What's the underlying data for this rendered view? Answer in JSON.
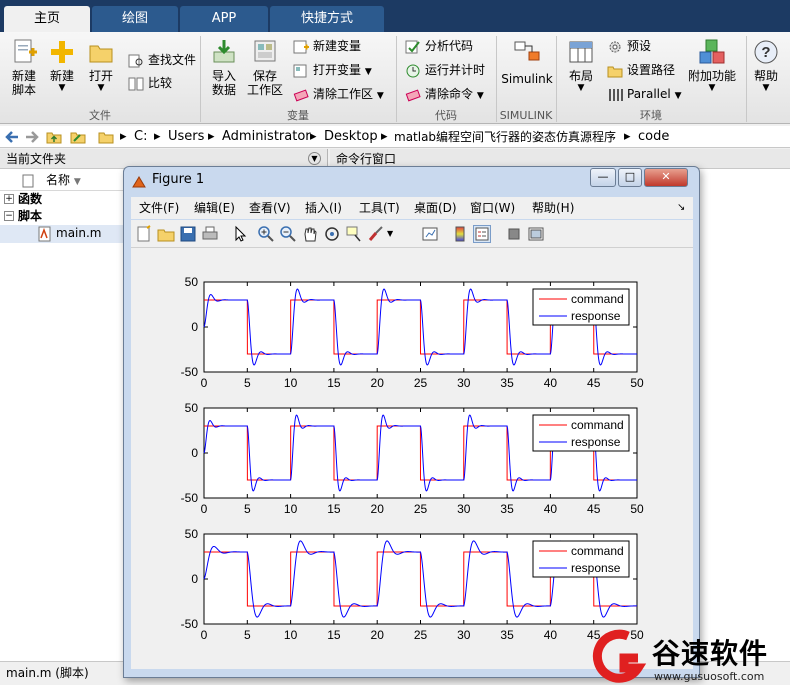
{
  "tabs": [
    {
      "label": "主页",
      "active": true
    },
    {
      "label": "绘图",
      "active": false
    },
    {
      "label": "APP",
      "active": false
    },
    {
      "label": "快捷方式",
      "active": false
    }
  ],
  "ribbon": {
    "new_script": "新建\n脚本",
    "new": "新建",
    "open": "打开",
    "find_files": "查找文件",
    "compare": "比较",
    "import_data": "导入\n数据",
    "save_workspace": "保存\n工作区",
    "new_variable": "新建变量",
    "open_variable": "打开变量",
    "clear_workspace": "清除工作区",
    "analyze_code": "分析代码",
    "run_and_time": "运行并计时",
    "clear_commands": "清除命令",
    "simulink": "Simulink",
    "layout": "布局",
    "preferences": "预设",
    "set_path": "设置路径",
    "parallel": "Parallel",
    "addons": "附加功能",
    "help": "帮助",
    "groups": {
      "file": "文件",
      "variable": "变量",
      "code": "代码",
      "simulink": "SIMULINK",
      "environment": "环境"
    }
  },
  "address": {
    "crumbs": [
      "C:",
      "Users",
      "Administrator",
      "Desktop",
      "matlab编程空间飞行器的姿态仿真源程序",
      "code"
    ]
  },
  "left_panel": {
    "title": "当前文件夹",
    "column": "名称",
    "tree": [
      {
        "label": "函数",
        "toggle": "+",
        "bold": true
      },
      {
        "label": "脚本",
        "toggle": "−",
        "bold": true
      },
      {
        "label": "main.m",
        "toggle": "",
        "bold": false,
        "selected": true
      }
    ]
  },
  "right_panel": {
    "title": "命令行窗口"
  },
  "status": {
    "text": "main.m  (脚本)"
  },
  "figure": {
    "title": "Figure 1",
    "menu": [
      "文件(F)",
      "编辑(E)",
      "查看(V)",
      "插入(I)",
      "工具(T)",
      "桌面(D)",
      "窗口(W)",
      "帮助(H)"
    ],
    "win_buttons": {
      "minimize": "—",
      "maximize": "□",
      "close": "✕"
    },
    "colors": {
      "command": "#ff0000",
      "response": "#0000ff"
    }
  },
  "chart_data": [
    {
      "type": "line",
      "xlim": [
        0,
        50
      ],
      "ylim": [
        -50,
        50
      ],
      "xticks": [
        0,
        5,
        10,
        15,
        20,
        25,
        30,
        35,
        40,
        45,
        50
      ],
      "yticks": [
        50,
        0,
        -50
      ],
      "legend": {
        "placement": "top-right",
        "entries": [
          "command",
          "response"
        ]
      },
      "series": [
        {
          "name": "command",
          "description": "square wave ±30, period 10",
          "amplitude": 30,
          "period": 10
        },
        {
          "name": "response",
          "amplitude": 30,
          "period": 10,
          "overshoot": 0.15,
          "rise": 0.8
        }
      ]
    },
    {
      "type": "line",
      "xlim": [
        0,
        50
      ],
      "ylim": [
        -50,
        50
      ],
      "xticks": [
        0,
        5,
        10,
        15,
        20,
        25,
        30,
        35,
        40,
        45,
        50
      ],
      "yticks": [
        50,
        0,
        -50
      ],
      "legend": {
        "placement": "top-right",
        "entries": [
          "command",
          "response"
        ]
      },
      "series": [
        {
          "name": "command",
          "amplitude": 30,
          "period": 10
        },
        {
          "name": "response",
          "amplitude": 30,
          "period": 10,
          "overshoot": 0.12,
          "rise": 0.7
        }
      ]
    },
    {
      "type": "line",
      "xlim": [
        0,
        50
      ],
      "ylim": [
        -50,
        50
      ],
      "xticks": [
        0,
        5,
        10,
        15,
        20,
        25,
        30,
        35,
        40,
        45,
        50
      ],
      "yticks": [
        50,
        0,
        -50
      ],
      "legend": {
        "placement": "top-right",
        "entries": [
          "command",
          "response"
        ]
      },
      "series": [
        {
          "name": "command",
          "amplitude": 30,
          "period": 10
        },
        {
          "name": "response",
          "amplitude": 30,
          "period": 10,
          "overshoot": 0.35,
          "rise": 1.2
        }
      ]
    }
  ],
  "watermark": {
    "brand": "谷速软件",
    "url": "www.gusuosoft.com"
  }
}
